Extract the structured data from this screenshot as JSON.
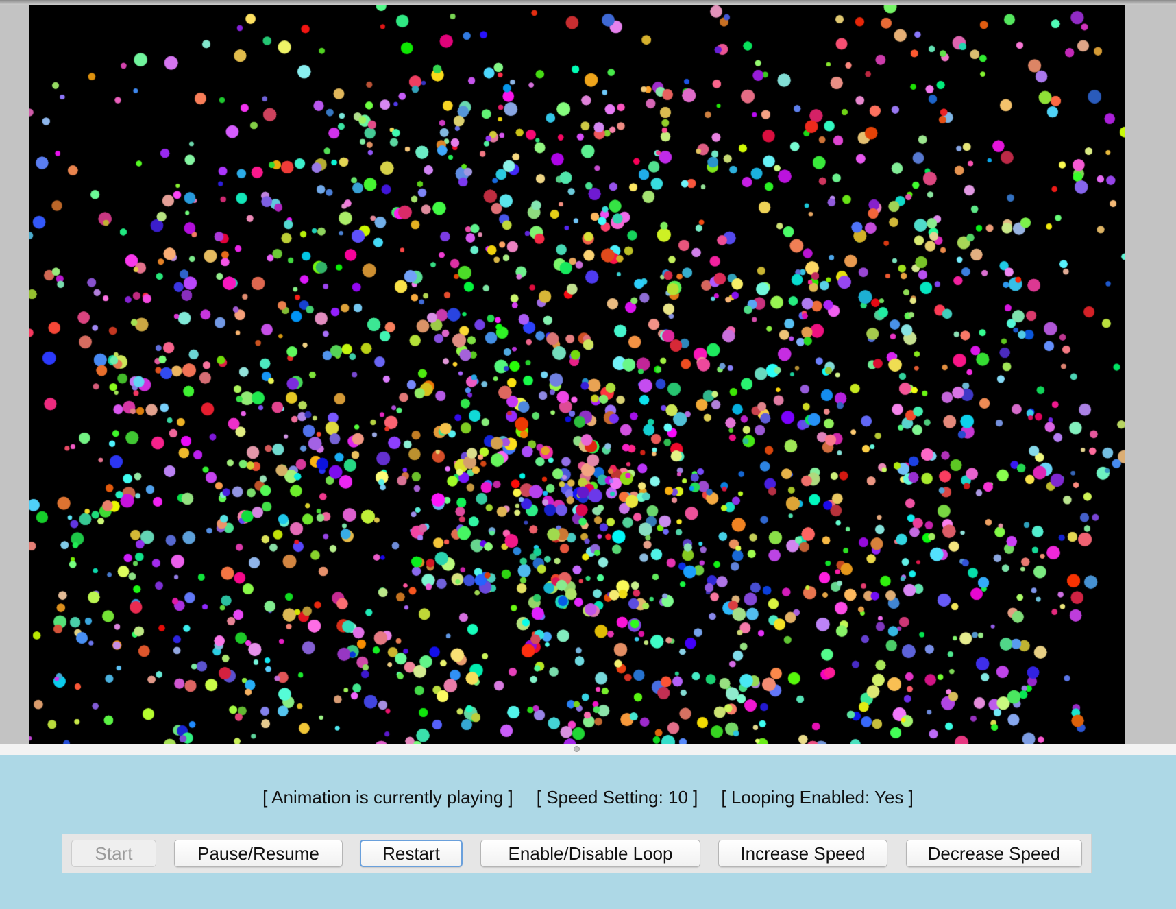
{
  "status": {
    "playing_text": "[ Animation is currently playing ]",
    "speed_text": "[ Speed Setting: 10 ]",
    "loop_text": "[ Looping Enabled: Yes ]"
  },
  "buttons": {
    "start": "Start",
    "pause_resume": "Pause/Resume",
    "restart": "Restart",
    "loop_toggle": "Enable/Disable Loop",
    "increase_speed": "Increase Speed",
    "decrease_speed": "Decrease Speed"
  },
  "colors": {
    "canvas_background": "#000000",
    "panel_background": "#add8e6",
    "button_bar_background": "#e6e6e6",
    "focus_ring": "#6aa0dc"
  }
}
